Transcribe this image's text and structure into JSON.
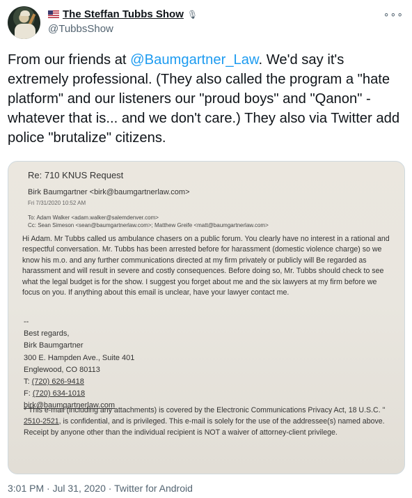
{
  "account": {
    "display_name": "The Steffan Tubbs Show",
    "handle": "@TubbsShow"
  },
  "tweet": {
    "text_before_mention": "From our friends at ",
    "mention": "@Baumgartner_Law",
    "text_after_mention": ". We'd say it's extremely professional. (They also called the program a \"hate platform\" and our listeners our \"proud boys\" and \"Qanon\" - whatever that is... and we don't care.) They also via Twitter add police \"brutalize\" citizens."
  },
  "image": {
    "subject": "Re: 710 KNUS Request",
    "from": "Birk Baumgartner <birk@baumgartnerlaw.com>",
    "date": "Fri 7/31/2020 10:52 AM",
    "to": "To:  Adam Walker <adam.walker@salemdenver.com>",
    "cc": "Cc:  Sean Simeson <sean@baumgartnerlaw.com>; Matthew Greife <matt@baumgartnerlaw.com>",
    "body": "Hi Adam. Mr Tubbs called us ambulance chasers on a public forum. You clearly have no interest in a rational and respectful conversation. Mr. Tubbs has been arrested before for harassment (domestic violence charge) so we know his m.o. and any further communications directed at my firm privately or publicly will Be regarded as harassment and will result in severe and costly consequences. Before doing so, Mr. Tubbs should check to see what the legal budget is for the show. I suggest you forget about me and the six lawyers at my firm before we focus on you. If anything about this email is unclear, have your lawyer contact me.",
    "sig_dashes": "--",
    "sig_regards": "Best regards,",
    "sig_name": "Birk Baumgartner",
    "sig_addr1": "300 E. Hampden Ave., Suite 401",
    "sig_addr2": "Englewood, CO 80113",
    "sig_t_label": "T: ",
    "sig_phone": "(720) 626-9418",
    "sig_f_label": "F: ",
    "sig_fax": "(720) 634-1018",
    "sig_email": "birk@baumgartnerlaw.com",
    "disclaimer_a": "* This e-mail (including any attachments) is covered by the Electronic Communications Privacy Act, 18 U.S.C. \" ",
    "disclaimer_link": "2510-2521",
    "disclaimer_b": ", is confidential, and is privileged. This e-mail is solely for the use of the addressee(s) named above. Receipt by anyone other than the individual recipient is NOT a waiver of attorney-client privilege."
  },
  "footer": {
    "time": "3:01 PM · Jul 31, 2020 · ",
    "source": "Twitter for Android"
  }
}
